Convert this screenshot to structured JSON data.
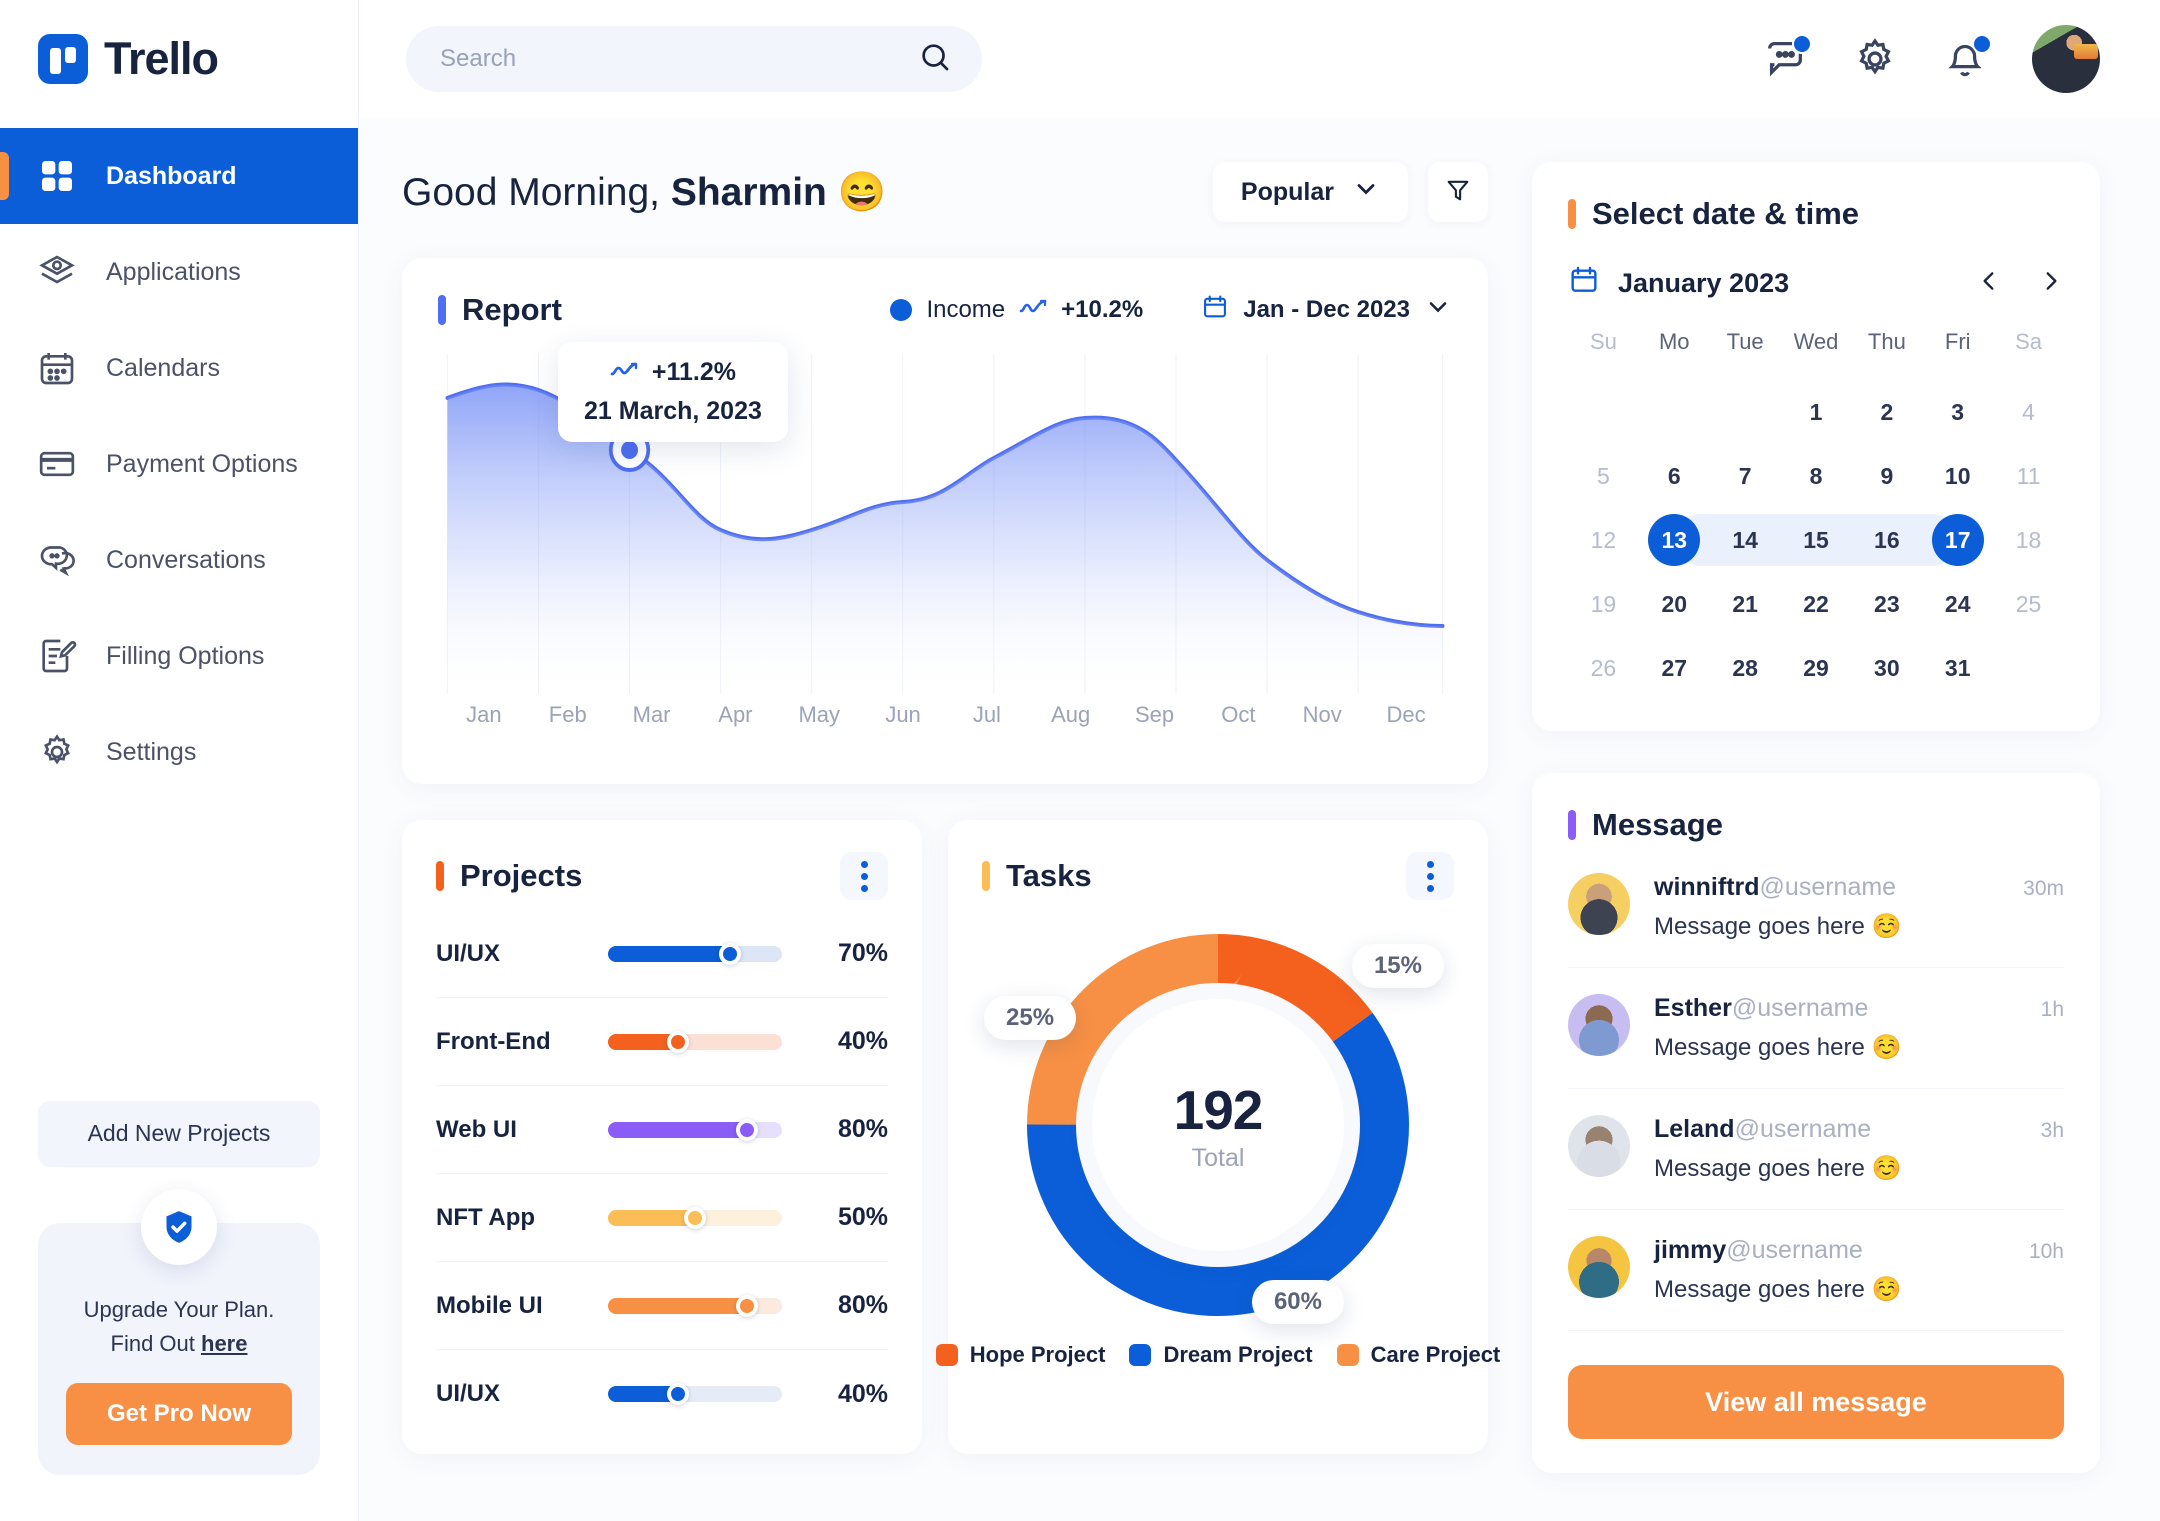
{
  "brand": {
    "name": "Trello"
  },
  "sidebar": {
    "items": [
      {
        "label": "Dashboard",
        "icon": "grid-icon",
        "active": true
      },
      {
        "label": "Applications",
        "icon": "layers-icon",
        "active": false
      },
      {
        "label": "Calendars",
        "icon": "calendar-icon",
        "active": false
      },
      {
        "label": "Payment Options",
        "icon": "credit-card-icon",
        "active": false
      },
      {
        "label": "Conversations",
        "icon": "chat-bubbles-icon",
        "active": false
      },
      {
        "label": "Filling Options",
        "icon": "document-edit-icon",
        "active": false
      },
      {
        "label": "Settings",
        "icon": "gear-icon",
        "active": false
      }
    ],
    "add_projects_label": "Add New Projects",
    "upgrade": {
      "line1": "Upgrade Your Plan.",
      "line2_prefix": "Find Out ",
      "link": "here",
      "cta": "Get Pro Now"
    }
  },
  "topbar": {
    "search_placeholder": "Search",
    "search_value": ""
  },
  "header": {
    "greeting_prefix": "Good Morning, ",
    "user": "Sharmin",
    "emoji": "😄",
    "sort_label": "Popular"
  },
  "report": {
    "title": "Report",
    "legend_label": "Income",
    "legend_change": "+10.2%",
    "range_label": "Jan - Dec 2023",
    "tooltip": {
      "change": "+11.2%",
      "date": "21 March, 2023"
    }
  },
  "projects": {
    "title": "Projects",
    "rows": [
      {
        "name": "UI/UX",
        "pct": "70%",
        "value": 70,
        "color": "#0b5ed7",
        "track": "#dde6f7"
      },
      {
        "name": "Front-End",
        "pct": "40%",
        "value": 40,
        "color": "#f4601e",
        "track": "#fde0d5"
      },
      {
        "name": "Web UI",
        "pct": "80%",
        "value": 80,
        "color": "#8b5cf6",
        "track": "#e7e0fd"
      },
      {
        "name": "NFT App",
        "pct": "50%",
        "value": 50,
        "color": "#fbbd55",
        "track": "#fdf1dd"
      },
      {
        "name": "Mobile UI",
        "pct": "80%",
        "value": 80,
        "color": "#f79044",
        "track": "#fdeade"
      },
      {
        "name": "UI/UX",
        "pct": "40%",
        "value": 40,
        "color": "#0b5ed7",
        "track": "#e6ecf7"
      }
    ]
  },
  "tasks": {
    "title": "Tasks",
    "total": "192",
    "total_label": "Total",
    "bubbles": {
      "hope": "15%",
      "care": "25%",
      "dream": "60%"
    }
  },
  "calendar": {
    "title": "Select date & time",
    "month_label": "January 2023",
    "dow": [
      "Su",
      "Mo",
      "Tue",
      "Wed",
      "Thu",
      "Fri",
      "Sa"
    ],
    "weeks": [
      [
        null,
        null,
        null,
        "1",
        "2",
        "3",
        "4"
      ],
      [
        "5",
        "6",
        "7",
        "8",
        "9",
        "10",
        "11"
      ],
      [
        "12",
        "13",
        "14",
        "15",
        "16",
        "17",
        "18"
      ],
      [
        "19",
        "20",
        "21",
        "22",
        "23",
        "24",
        "25"
      ],
      [
        "26",
        "27",
        "28",
        "29",
        "30",
        "31",
        null
      ]
    ],
    "selected": [
      "13",
      "17"
    ],
    "range": [
      "13",
      "14",
      "15",
      "16",
      "17"
    ]
  },
  "messages": {
    "title": "Message",
    "items": [
      {
        "user": "winniftrd",
        "handle": "@username",
        "text": "Message goes here  ☺️",
        "time": "30m"
      },
      {
        "user": "Esther",
        "handle": "@username",
        "text": "Message goes here  ☺️",
        "time": "1h"
      },
      {
        "user": "Leland",
        "handle": "@username",
        "text": "Message goes here  ☺️",
        "time": "3h"
      },
      {
        "user": "jimmy",
        "handle": "@username",
        "text": "Message goes here  ☺️",
        "time": "10h"
      }
    ],
    "view_all_label": "View all message"
  },
  "chart_data": [
    {
      "type": "area",
      "title": "Report",
      "xlabel": "",
      "ylabel": "",
      "categories": [
        "Jan",
        "Feb",
        "Mar",
        "Apr",
        "May",
        "Jun",
        "Jul",
        "Aug",
        "Sep",
        "Oct",
        "Nov",
        "Dec"
      ],
      "series": [
        {
          "name": "Income",
          "values": [
            90,
            94,
            80,
            58,
            42,
            46,
            66,
            82,
            72,
            55,
            38,
            28
          ]
        }
      ],
      "ylim": [
        0,
        100
      ],
      "grid": "vertical",
      "legend": "top-right",
      "line_color": "#4f6ef0",
      "annotations": [
        {
          "x": "Mar",
          "label": "+11.2%",
          "sublabel": "21 March, 2023",
          "marker": true
        }
      ]
    },
    {
      "type": "pie",
      "title": "Tasks",
      "center_value": "192",
      "center_label": "Total",
      "labels": [
        "Hope Project",
        "Dream Project",
        "Care Project"
      ],
      "values": [
        15,
        60,
        25
      ],
      "colors": [
        "#f4601e",
        "#0b5ed7",
        "#f79044"
      ],
      "legend": "bottom"
    },
    {
      "type": "bar",
      "title": "Projects",
      "orientation": "horizontal",
      "categories": [
        "UI/UX",
        "Front-End",
        "Web UI",
        "NFT App",
        "Mobile UI",
        "UI/UX"
      ],
      "values": [
        70,
        40,
        80,
        50,
        80,
        40
      ],
      "ylim": [
        0,
        100
      ],
      "colors": [
        "#0b5ed7",
        "#f4601e",
        "#8b5cf6",
        "#fbbd55",
        "#f79044",
        "#0b5ed7"
      ]
    }
  ]
}
